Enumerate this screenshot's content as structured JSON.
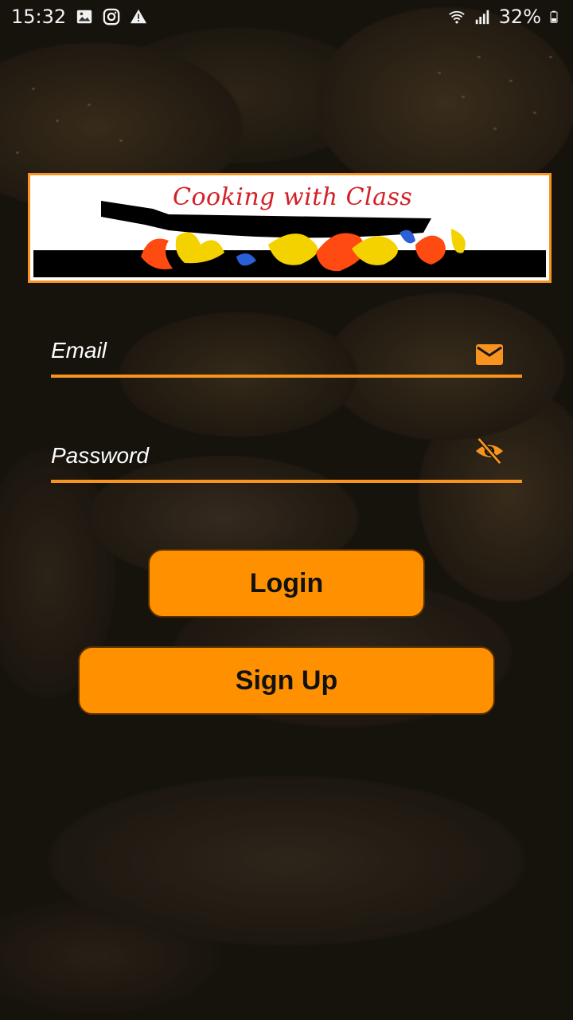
{
  "status_bar": {
    "time": "15:32",
    "left_icons": [
      "image-icon",
      "instagram-icon",
      "warning-icon"
    ],
    "right_icons": [
      "wifi-icon",
      "signal-icon",
      "battery-icon"
    ],
    "battery": "32%"
  },
  "logo": {
    "title": "Cooking with Class",
    "border_color": "#f7931e"
  },
  "form": {
    "email": {
      "placeholder": "Email",
      "icon": "mail-icon"
    },
    "password": {
      "placeholder": "Password",
      "icon": "visibility-off-icon"
    }
  },
  "buttons": {
    "login": "Login",
    "signup": "Sign Up"
  },
  "colors": {
    "accent": "#ff9100",
    "underline": "#f7931e"
  }
}
